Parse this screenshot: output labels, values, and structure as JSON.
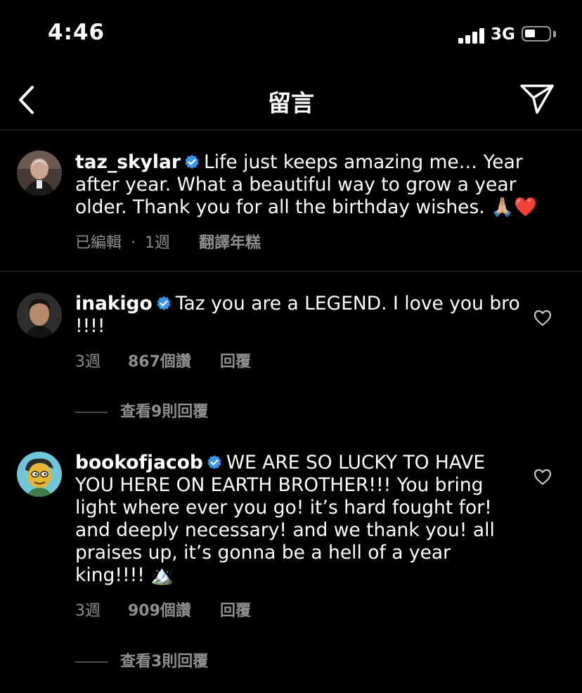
{
  "status_bar": {
    "time": "4:46",
    "network": "3G"
  },
  "header": {
    "title": "留言"
  },
  "caption": {
    "username": "taz_skylar",
    "text": "Life just keeps amazing me… Year after year. What a beautiful way to grow a year older. Thank you for all the birthday wishes. 🙏🏼❤️",
    "edited": "已編輯",
    "separator": "·",
    "time": "1週",
    "translate": "翻譯年糕"
  },
  "comments": [
    {
      "username": "inakigo",
      "text": "Taz you are a LEGEND. I love you bro !!!!",
      "time": "3週",
      "likes": "867個讚",
      "reply": "回覆",
      "view_replies": "查看9則回覆"
    },
    {
      "username": "bookofjacob",
      "text": "WE ARE SO LUCKY TO HAVE YOU HERE ON EARTH BROTHER!!! You bring light where ever you go! it’s hard fought for! and deeply necessary! and we thank you! all praises up, it’s gonna be a hell of a year king!!!! 🏔️",
      "time": "3週",
      "likes": "909個讚",
      "reply": "回覆",
      "view_replies": "查看3則回覆"
    }
  ],
  "colors": {
    "background": "#000000",
    "text": "#ffffff",
    "secondary_text": "#8e8e8e",
    "verified_badge": "#3797f0",
    "divider": "#262626"
  }
}
